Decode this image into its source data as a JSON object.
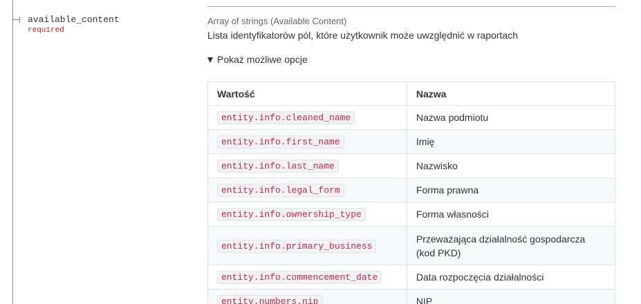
{
  "property": {
    "name": "available_content",
    "required_label": "required"
  },
  "schema": {
    "type_text": "Array of strings (Available Content)",
    "description": "Lista identyfikatorów pól, które użytkownik może uwzględnić w raportach",
    "options_toggle_label": "Pokaż możliwe opcje"
  },
  "options_table": {
    "headers": [
      "Wartość",
      "Nazwa"
    ],
    "rows": [
      {
        "value": "entity.info.cleaned_name",
        "name": "Nazwa podmiotu"
      },
      {
        "value": "entity.info.first_name",
        "name": "Imię"
      },
      {
        "value": "entity.info.last_name",
        "name": "Nazwisko"
      },
      {
        "value": "entity.info.legal_form",
        "name": "Forma prawna"
      },
      {
        "value": "entity.info.ownership_type",
        "name": "Forma własności"
      },
      {
        "value": "entity.info.primary_business",
        "name": "Przeważająca działalność gospodarcza (kod PKD)"
      },
      {
        "value": "entity.info.commencement_date",
        "name": "Data rozpoczęcia działalności"
      },
      {
        "value": "entity.numbers.nip",
        "name": "NIP"
      }
    ]
  },
  "colors": {
    "required": "#d41f1c",
    "code_text": "#c7254e",
    "stripe": "#f6f8fa"
  }
}
